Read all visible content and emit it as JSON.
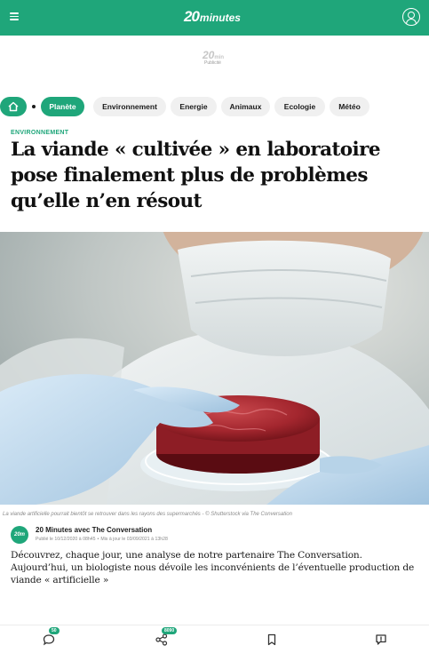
{
  "header": {
    "logo_number": "20",
    "logo_text": "minutes",
    "brand_color": "#1fa67a",
    "menu_icon": "hamburger-menu-icon",
    "account_icon": "user-account-icon"
  },
  "ad": {
    "logo_number": "20",
    "logo_text": "min",
    "label": "Publicité"
  },
  "nav": {
    "home_icon": "home-icon",
    "items": [
      {
        "label": "Planète",
        "active": true
      },
      {
        "label": "Environnement",
        "active": false
      },
      {
        "label": "Energie",
        "active": false
      },
      {
        "label": "Animaux",
        "active": false
      },
      {
        "label": "Ecologie",
        "active": false
      },
      {
        "label": "Météo",
        "active": false
      }
    ]
  },
  "article": {
    "rubric": "ENVIRONNEMENT",
    "title": "La viande « cultivée » en laboratoire pose finalement plus de problèmes qu’elle n’en résout",
    "caption": "La viande artificielle pourrait bientôt se retrouver dans les rayons des supermarchés - © Shutterstock via The Conversation",
    "author": {
      "avatar_text": "20m",
      "name": "20 Minutes avec The Conversation",
      "published": "Publié le 10/12/2020 à 08h45",
      "updated": "Mis à jour le 03/09/2021 à 13h28"
    },
    "lead": "Découvrez, chaque jour, une analyse de notre partenaire The Conversation. Aujourd’hui, un biologiste nous dévoile les inconvénients de l’éventuelle production de viande « artificielle »"
  },
  "bottom_bar": {
    "comments_icon": "comment-icon",
    "comments_count": "50",
    "share_icon": "share-icon",
    "share_count": "8090",
    "bookmark_icon": "bookmark-icon",
    "report_icon": "report-icon"
  }
}
